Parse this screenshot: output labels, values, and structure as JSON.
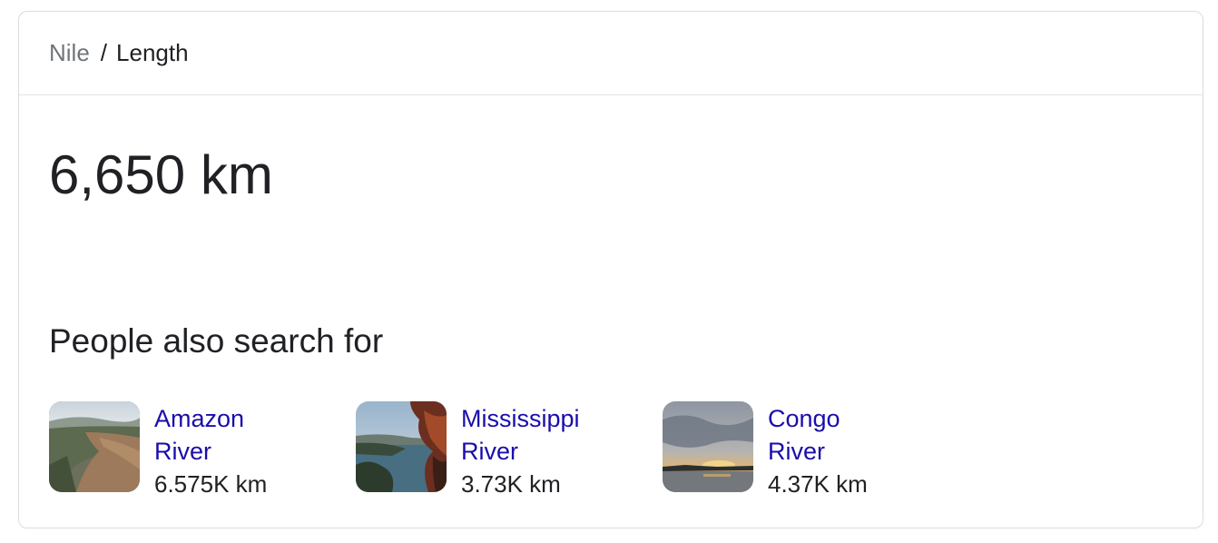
{
  "breadcrumb": {
    "parent": "Nile",
    "separator": "/",
    "current": "Length"
  },
  "answer": "6,650 km",
  "also_search": {
    "title": "People also search for",
    "items": [
      {
        "name": "Amazon River",
        "value": "6.575K km",
        "icon": "amazon-river-photo"
      },
      {
        "name": "Mississippi River",
        "value": "3.73K km",
        "icon": "mississippi-river-photo"
      },
      {
        "name": "Congo River",
        "value": "4.37K km",
        "icon": "congo-river-photo"
      }
    ]
  },
  "colors": {
    "link": "#1a0dab",
    "text": "#202124",
    "muted": "#70757a",
    "border": "#dadce0"
  }
}
